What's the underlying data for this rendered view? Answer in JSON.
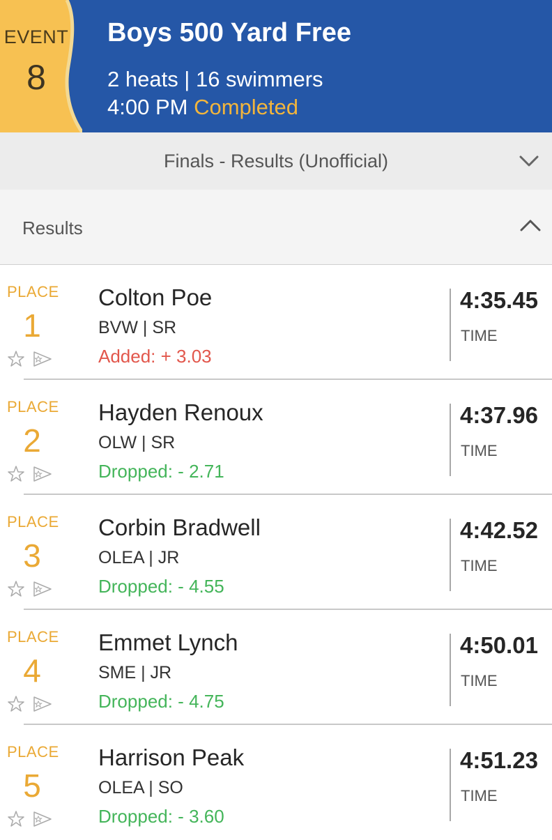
{
  "header": {
    "event_label": "EVENT",
    "event_number": "8",
    "title": "Boys 500 Yard Free",
    "meta": "2 heats | 16 swimmers",
    "time": "4:00 PM",
    "status": "Completed",
    "accent_color": "#f2b53c",
    "brand_color": "#2557a7"
  },
  "finals": {
    "label": "Finals - Results (Unofficial)",
    "icon": "chevron-down-icon"
  },
  "results_section": {
    "label": "Results",
    "icon": "chevron-up-icon"
  },
  "results": [
    {
      "place_label": "PLACE",
      "place": "1",
      "name": "Colton Poe",
      "team": "BVW | SR",
      "delta": "Added: + 3.03",
      "delta_type": "added",
      "time": "4:35.45",
      "time_label": "TIME"
    },
    {
      "place_label": "PLACE",
      "place": "2",
      "name": "Hayden Renoux",
      "team": "OLW | SR",
      "delta": "Dropped: - 2.71",
      "delta_type": "dropped",
      "time": "4:37.96",
      "time_label": "TIME"
    },
    {
      "place_label": "PLACE",
      "place": "3",
      "name": "Corbin Bradwell",
      "team": "OLEA | JR",
      "delta": "Dropped: - 4.55",
      "delta_type": "dropped",
      "time": "4:42.52",
      "time_label": "TIME"
    },
    {
      "place_label": "PLACE",
      "place": "4",
      "name": "Emmet Lynch",
      "team": "SME | JR",
      "delta": "Dropped: - 4.75",
      "delta_type": "dropped",
      "time": "4:50.01",
      "time_label": "TIME"
    },
    {
      "place_label": "PLACE",
      "place": "5",
      "name": "Harrison Peak",
      "team": "OLEA | SO",
      "delta": "Dropped: - 3.60",
      "delta_type": "dropped",
      "time": "4:51.23",
      "time_label": "TIME"
    }
  ]
}
